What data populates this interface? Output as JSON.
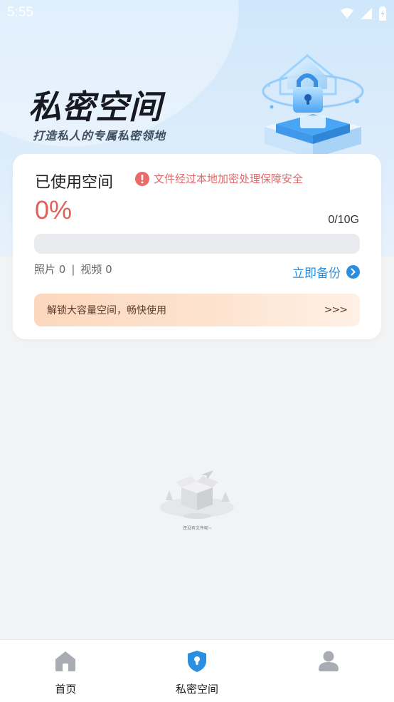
{
  "status_bar": {
    "time": "5:55"
  },
  "hero": {
    "title": "私密空间",
    "subtitle": "打造私人的专属私密领地"
  },
  "storage_card": {
    "used_label": "已使用空间",
    "notice_text": "文件经过本地加密处理保障安全",
    "percent_text": "0%",
    "usage_ratio": 0,
    "capacity_text": "0/10G",
    "photos_text": "照片 0",
    "separator": "|",
    "videos_text": "视频 0",
    "backup_label": "立即备份",
    "unlock_text": "解锁大容量空间，畅快使用",
    "unlock_arrows": ">>>"
  },
  "empty_state": {
    "text": "还没有文件呢~"
  },
  "bottom_nav": {
    "items": [
      {
        "label": "首页",
        "icon": "home-icon",
        "active": false
      },
      {
        "label": "私密空间",
        "icon": "shield-lock-icon",
        "active": true
      },
      {
        "label": "",
        "icon": "user-icon",
        "active": false
      }
    ]
  },
  "colors": {
    "accent": "#2a8fe0",
    "danger": "#e0605a",
    "nav_inactive": "#a9adb3"
  }
}
